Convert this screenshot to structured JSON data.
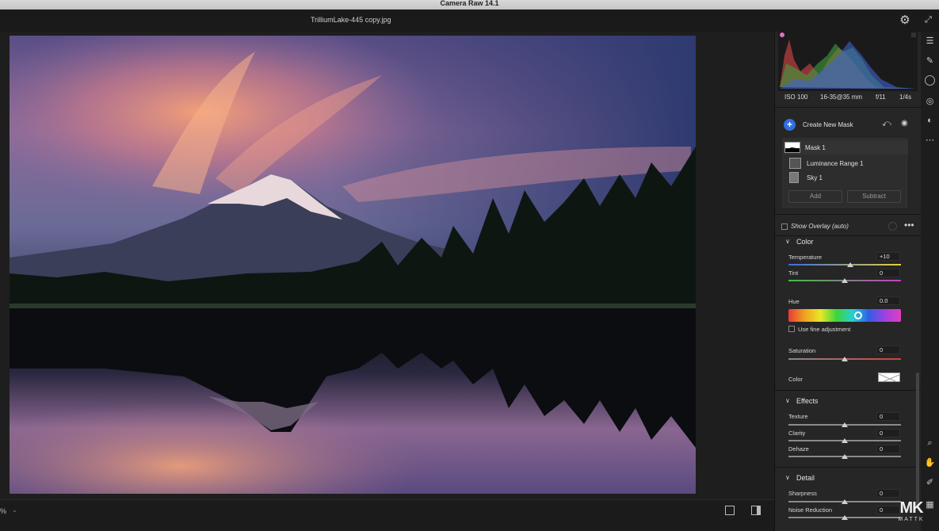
{
  "window": {
    "app_title": "Camera Raw 14.1",
    "file_name": "TrilliumLake-445 copy.jpg"
  },
  "header": {
    "settings_icon": "gear-icon",
    "expand_icon": "expand-icon"
  },
  "bottom_bar": {
    "zoom": "%"
  },
  "exif": {
    "iso": "ISO 100",
    "lens": "16-35@35 mm",
    "aperture": "f/11",
    "shutter": "1/4s"
  },
  "masks": {
    "create_label": "Create New Mask",
    "items": [
      {
        "label": "Mask 1"
      },
      {
        "label": "Luminance Range 1"
      },
      {
        "label": "Sky 1"
      }
    ],
    "add_label": "Add",
    "subtract_label": "Subtract",
    "overlay_label": "Show Overlay (auto)"
  },
  "color": {
    "title": "Color",
    "temperature": {
      "label": "Temperature",
      "value": "+10",
      "level": 0.55
    },
    "tint": {
      "label": "Tint",
      "value": "0",
      "level": 0.5
    },
    "hue": {
      "label": "Hue",
      "value": "0.0",
      "level": 0.5
    },
    "fine_adjust_label": "Use fine adjustment",
    "saturation": {
      "label": "Saturation",
      "value": "0",
      "level": 0.5
    },
    "color_label": "Color"
  },
  "effects": {
    "title": "Effects",
    "texture": {
      "label": "Texture",
      "value": "0",
      "level": 0.5
    },
    "clarity": {
      "label": "Clarity",
      "value": "0",
      "level": 0.5
    },
    "dehaze": {
      "label": "Dehaze",
      "value": "0",
      "level": 0.5
    }
  },
  "detail": {
    "title": "Detail",
    "sharpness": {
      "label": "Sharpness",
      "value": "0",
      "level": 0.5
    },
    "noise": {
      "label": "Noise Reduction",
      "value": "0",
      "level": 0.5
    }
  },
  "watermark": {
    "logo": "MK",
    "name": "MATTK"
  },
  "colors": {
    "accent": "#2f6fe0",
    "panel": "#262626",
    "canvas": "#1e1e1e"
  }
}
